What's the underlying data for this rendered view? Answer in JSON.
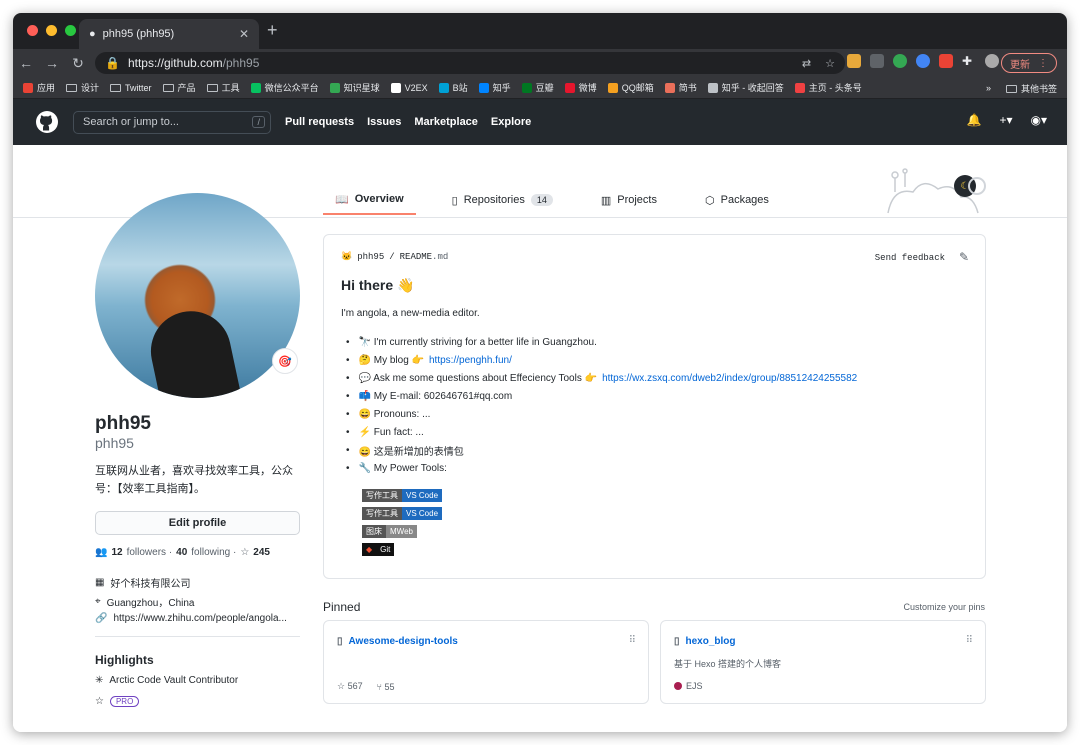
{
  "browser": {
    "tab_title": "phh95 (phh95)",
    "url_host": "https://github.com",
    "url_path": "/phh95",
    "update_label": "更新",
    "bookmarks": [
      "应用",
      "设计",
      "Twitter",
      "产品",
      "工具",
      "微信公众平台",
      "知识星球",
      "V2EX",
      "B站",
      "知乎",
      "豆瓣",
      "微博",
      "QQ邮箱",
      "简书",
      "知乎 - 收起回答",
      "主页 - 头条号"
    ],
    "more": "»",
    "other_bookmarks": "其他书签"
  },
  "github": {
    "search_placeholder": "Search or jump to...",
    "search_key": "/",
    "nav": [
      "Pull requests",
      "Issues",
      "Marketplace",
      "Explore"
    ]
  },
  "tabs": {
    "overview": "Overview",
    "repositories": "Repositories",
    "repo_count": "14",
    "projects": "Projects",
    "packages": "Packages"
  },
  "profile": {
    "name": "phh95",
    "login": "phh95",
    "bio": "互联网从业者，喜欢寻找效率工具，公众号：【效率工具指南】。",
    "edit": "Edit profile",
    "followers": "12",
    "followers_label": "followers ·",
    "following": "40",
    "following_label": "following ·",
    "stars": "245",
    "company": "好个科技有限公司",
    "location": "Guangzhou，China",
    "link": "https://www.zhihu.com/people/angola...",
    "highlights_title": "Highlights",
    "highlight1": "Arctic Code Vault Contributor",
    "pro": "PRO"
  },
  "readme": {
    "user": "phh95",
    "file": "README",
    "ext": ".md",
    "feedback": "Send feedback",
    "heading": "Hi there 👋",
    "intro": "I'm angola, a new-media editor.",
    "items": [
      "🔭 I'm currently striving for a better life in Guangzhou.",
      "🤔 My blog 👉 ",
      "💬 Ask me some questions about Effeciency Tools 👉 ",
      "📫 My E-mail: 602646761#qq.com",
      "😄 Pronouns: ...",
      "⚡ Fun fact: ...",
      "😄 这是新增加的表情包",
      "🔧 My Power Tools:"
    ],
    "blog_link": "https://penghh.fun/",
    "zsxq_link": "https://wx.zsxq.com/dweb2/index/group/88512424255582",
    "badges": [
      {
        "l": "写作工具",
        "r": "VS Code"
      },
      {
        "l": "写作工具",
        "r": "VS Code"
      },
      {
        "l": "图床",
        "r": "MWeb"
      },
      {
        "l": "",
        "r": "Git"
      }
    ]
  },
  "pinned": {
    "title": "Pinned",
    "customize": "Customize your pins",
    "cards": [
      {
        "name": "Awesome-design-tools",
        "desc": "",
        "stars": "567",
        "forks": "55",
        "lang": ""
      },
      {
        "name": "hexo_blog",
        "desc": "基于 Hexo 搭建的个人博客",
        "stars": "",
        "forks": "",
        "lang": "EJS"
      }
    ]
  }
}
